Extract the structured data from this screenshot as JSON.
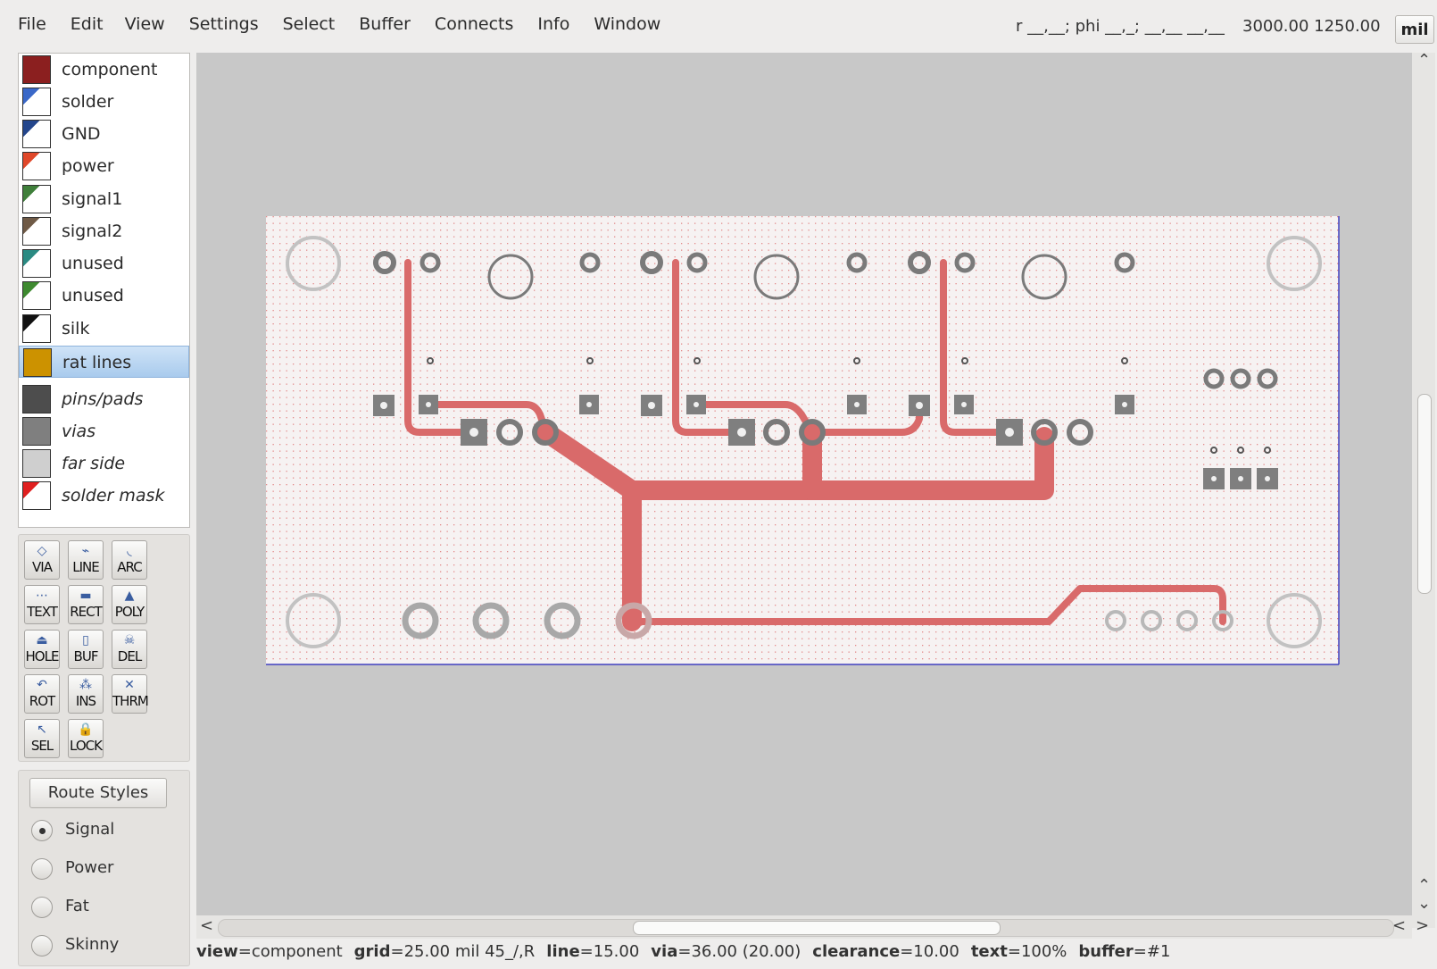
{
  "menu": [
    "File",
    "Edit",
    "View",
    "Settings",
    "Select",
    "Buffer",
    "Connects",
    "Info",
    "Window"
  ],
  "coords": {
    "relative": "r __,__; phi __,_; __,__ __,__",
    "absolute": "3000.00 1250.00",
    "units": "mil"
  },
  "layers": [
    {
      "label": "component",
      "color": "#8b1f1f",
      "style": "solid"
    },
    {
      "label": "solder",
      "color": "#3a68c8",
      "style": "corner"
    },
    {
      "label": "GND",
      "color": "#23468c",
      "style": "corner"
    },
    {
      "label": "power",
      "color": "#e0482a",
      "style": "corner"
    },
    {
      "label": "signal1",
      "color": "#3f7f3a",
      "style": "corner"
    },
    {
      "label": "signal2",
      "color": "#6f5a46",
      "style": "corner"
    },
    {
      "label": "unused",
      "color": "#2a8a82",
      "style": "corner"
    },
    {
      "label": "unused",
      "color": "#3e8a30",
      "style": "corner"
    },
    {
      "label": "silk",
      "color": "#111111",
      "style": "corner"
    },
    {
      "label": "rat lines",
      "color": "#cc9200",
      "style": "solid",
      "selected": true
    },
    {
      "label": "pins/pads",
      "color": "#4d4d4d",
      "style": "solid",
      "italic": true
    },
    {
      "label": "vias",
      "color": "#7f7f7f",
      "style": "solid",
      "italic": true
    },
    {
      "label": "far side",
      "color": "#cfcfcf",
      "style": "solid",
      "italic": true
    },
    {
      "label": "solder mask",
      "color": "#e02020",
      "style": "corner",
      "italic": true
    }
  ],
  "tools": [
    {
      "label": "VIA",
      "icon": "◇"
    },
    {
      "label": "LINE",
      "icon": "⌁"
    },
    {
      "label": "ARC",
      "icon": "◟"
    },
    {
      "label": "TEXT",
      "icon": "⋯"
    },
    {
      "label": "RECT",
      "icon": "▬"
    },
    {
      "label": "POLY",
      "icon": "▲"
    },
    {
      "label": "HOLE",
      "icon": "⏏"
    },
    {
      "label": "BUF",
      "icon": "▯"
    },
    {
      "label": "DEL",
      "icon": "☠"
    },
    {
      "label": "ROT",
      "icon": "↶"
    },
    {
      "label": "INS",
      "icon": "⁂"
    },
    {
      "label": "THRM",
      "icon": "✕"
    },
    {
      "label": "SEL",
      "icon": "↖"
    },
    {
      "label": "LOCK",
      "icon": "🔒"
    }
  ],
  "route_styles": {
    "title": "Route Styles",
    "options": [
      {
        "label": "Signal",
        "selected": true
      },
      {
        "label": "Power",
        "selected": false
      },
      {
        "label": "Fat",
        "selected": false
      },
      {
        "label": "Skinny",
        "selected": false
      }
    ]
  },
  "status": [
    {
      "key": "view",
      "val": "=component"
    },
    {
      "key": "grid",
      "val": "=25.00 mil  45_/,R"
    },
    {
      "key": "line",
      "val": "=15.00"
    },
    {
      "key": "via",
      "val": "=36.00 (20.00)"
    },
    {
      "key": "clearance",
      "val": "=10.00"
    },
    {
      "key": "text",
      "val": "=100%"
    },
    {
      "key": "buffer",
      "val": "=#1"
    }
  ],
  "colors": {
    "board_bg": "#f5f0f0",
    "trace": "#d96a6a",
    "pad": "#808080",
    "outline": "#4040c0"
  }
}
